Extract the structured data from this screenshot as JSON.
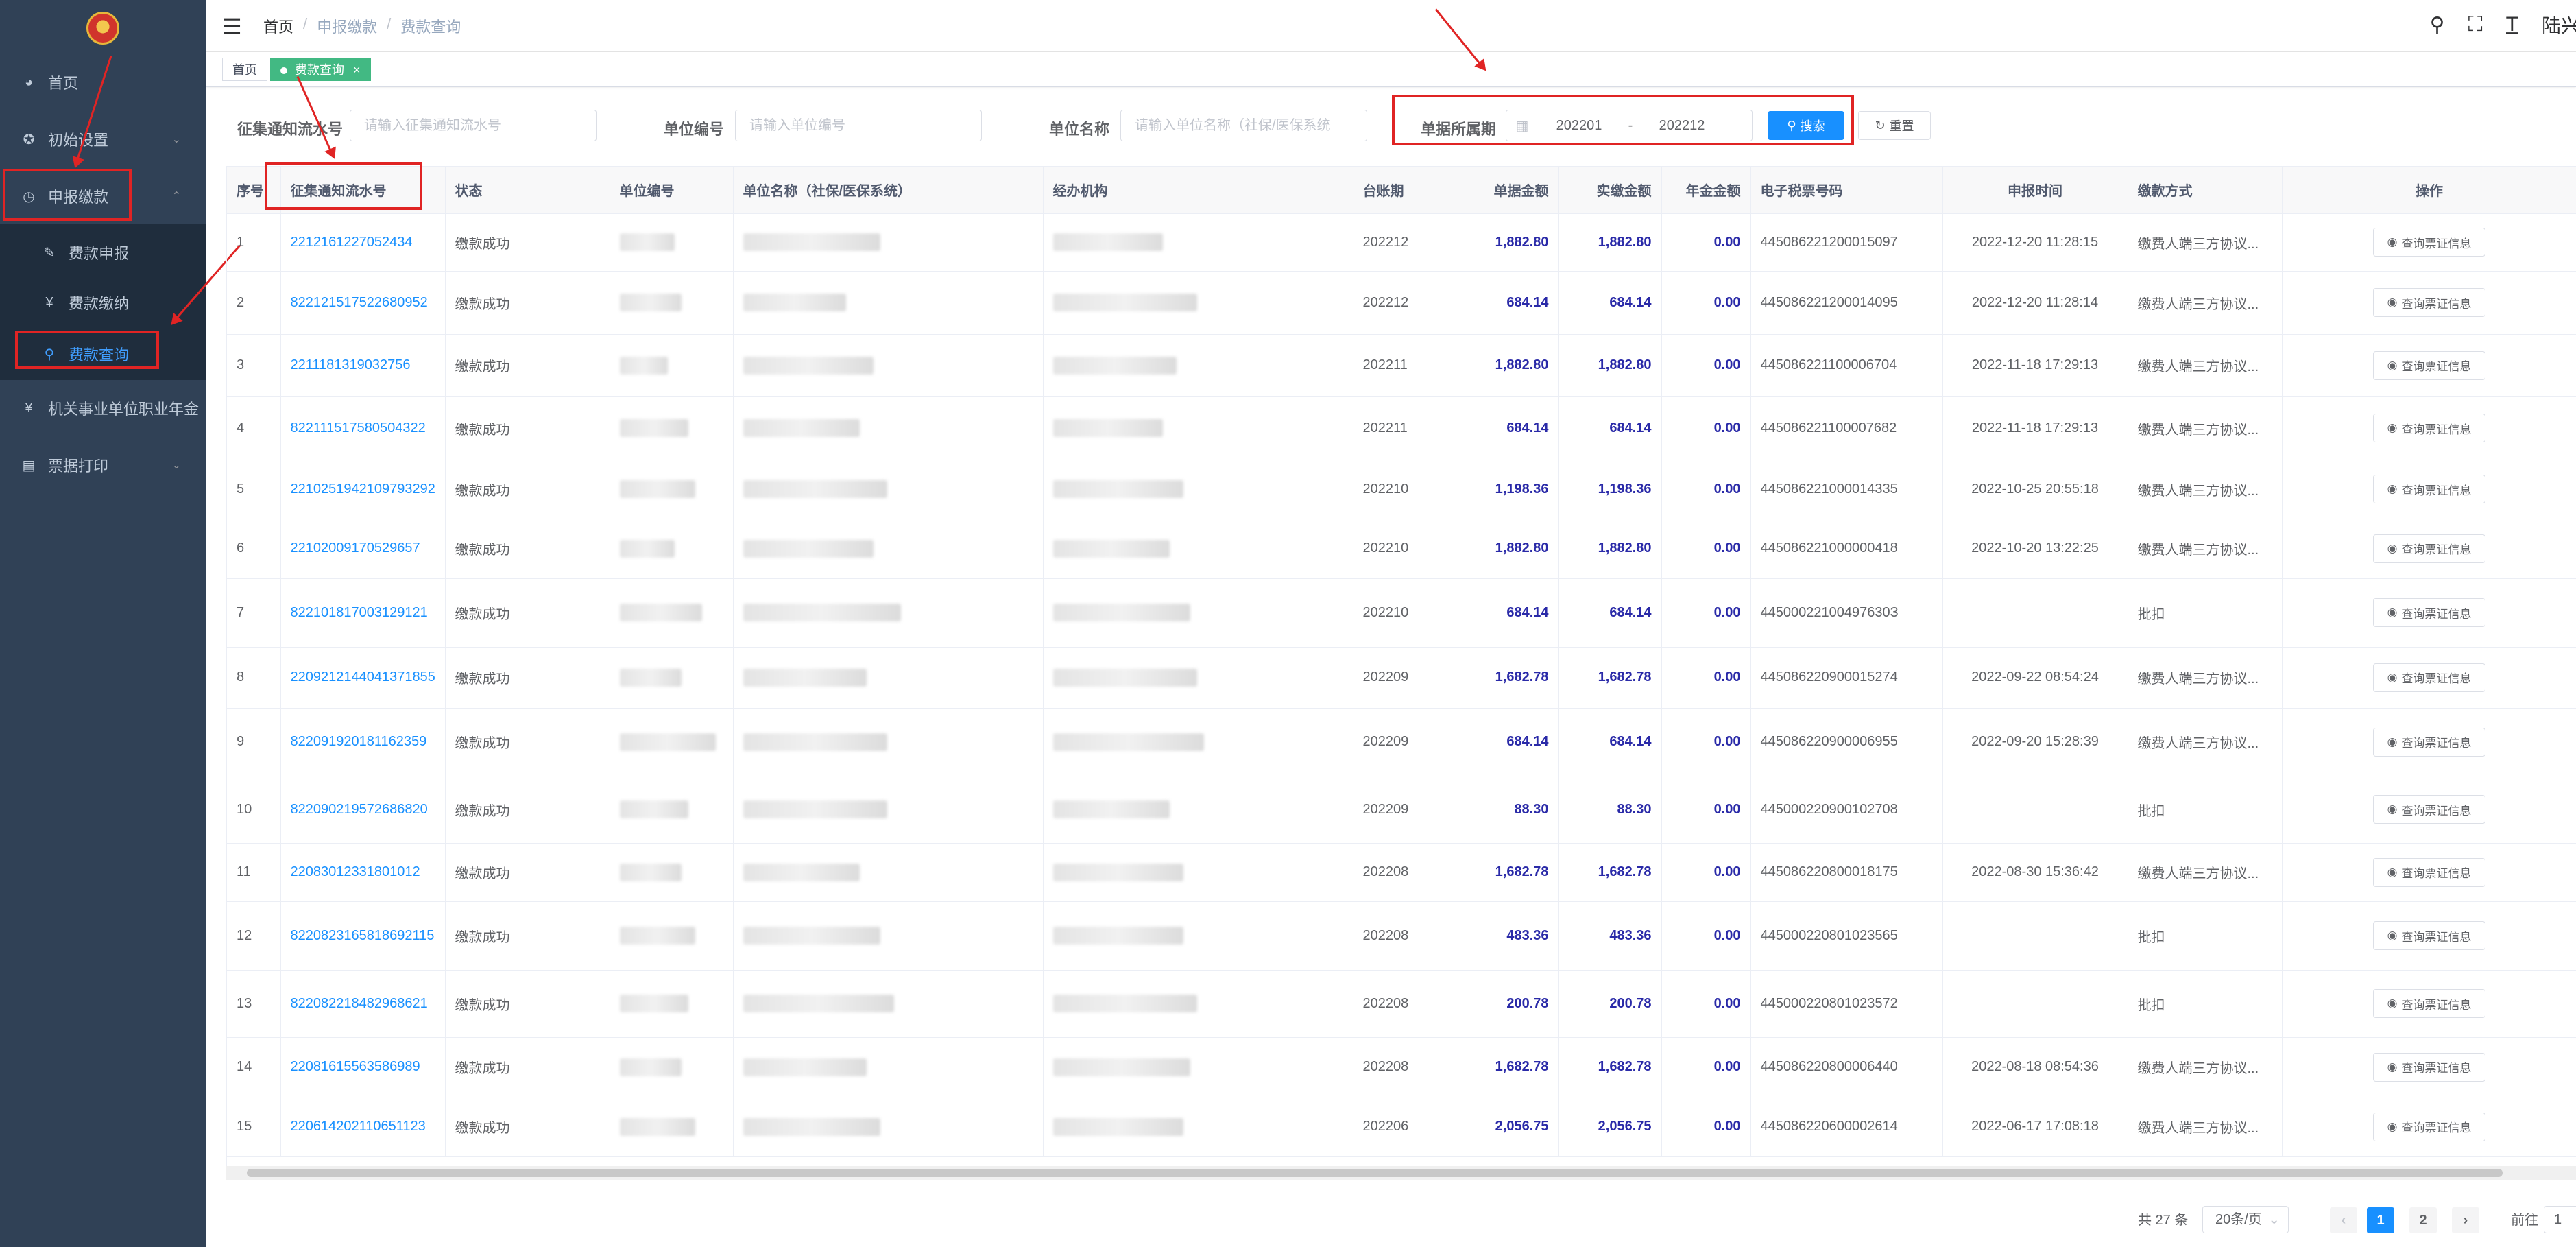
{
  "sidebar": {
    "items": [
      {
        "label": "首页",
        "icon": "dashboard-icon"
      },
      {
        "label": "初始设置",
        "icon": "settings-icon"
      },
      {
        "label": "申报缴款",
        "icon": "clock-icon"
      },
      {
        "label": "费款申报",
        "icon": "edit-icon"
      },
      {
        "label": "费款缴纳",
        "icon": "yen-icon"
      },
      {
        "label": "费款查询",
        "icon": "search-icon"
      },
      {
        "label": "机关事业单位职业年金",
        "icon": "yen-icon"
      },
      {
        "label": "票据打印",
        "icon": "printer-icon"
      }
    ]
  },
  "navbar": {
    "breadcrumb": [
      "首页",
      "申报缴款",
      "费款查询"
    ],
    "user": "陆兴"
  },
  "tags": [
    {
      "label": "首页"
    },
    {
      "label": "费款查询",
      "close": "×"
    }
  ],
  "filters": {
    "notice_label": "征集通知流水号",
    "notice_placeholder": "请输入征集通知流水号",
    "unit_no_label": "单位编号",
    "unit_no_placeholder": "请输入单位编号",
    "unit_name_label": "单位名称",
    "unit_name_placeholder": "请输入单位名称（社保/医保系统",
    "period_label": "单据所属期",
    "period_start": "202201",
    "period_sep": "-",
    "period_end": "202212",
    "search": "搜索",
    "reset": "重置"
  },
  "table": {
    "headers": [
      "序号",
      "征集通知流水号",
      "状态",
      "单位编号",
      "单位名称（社保/医保系统）",
      "经办机构",
      "台账期",
      "单据金额",
      "实缴金额",
      "年金金额",
      "电子税票号码",
      "申报时间",
      "缴款方式",
      "操作"
    ],
    "action_label": "查询票证信息",
    "rows": [
      {
        "no": "1",
        "serial": "2212161227052434",
        "status": "缴款成功",
        "period": "202212",
        "amount": "1,882.80",
        "paid": "1,882.80",
        "annuity": "0.00",
        "tax": "445086221200015097",
        "time": "2022-12-20 11:28:15",
        "method": "缴费人端三方协议..."
      },
      {
        "no": "2",
        "serial": "822121517522680952",
        "status": "缴款成功",
        "period": "202212",
        "amount": "684.14",
        "paid": "684.14",
        "annuity": "0.00",
        "tax": "445086221200014095",
        "time": "2022-12-20 11:28:14",
        "method": "缴费人端三方协议..."
      },
      {
        "no": "3",
        "serial": "2211181319032756",
        "status": "缴款成功",
        "period": "202211",
        "amount": "1,882.80",
        "paid": "1,882.80",
        "annuity": "0.00",
        "tax": "445086221100006704",
        "time": "2022-11-18 17:29:13",
        "method": "缴费人端三方协议..."
      },
      {
        "no": "4",
        "serial": "822111517580504322",
        "status": "缴款成功",
        "period": "202211",
        "amount": "684.14",
        "paid": "684.14",
        "annuity": "0.00",
        "tax": "445086221100007682",
        "time": "2022-11-18 17:29:13",
        "method": "缴费人端三方协议..."
      },
      {
        "no": "5",
        "serial": "2210251942109793292",
        "status": "缴款成功",
        "period": "202210",
        "amount": "1,198.36",
        "paid": "1,198.36",
        "annuity": "0.00",
        "tax": "445086221000014335",
        "time": "2022-10-25 20:55:18",
        "method": "缴费人端三方协议..."
      },
      {
        "no": "6",
        "serial": "22102009170529657",
        "status": "缴款成功",
        "period": "202210",
        "amount": "1,882.80",
        "paid": "1,882.80",
        "annuity": "0.00",
        "tax": "445086221000000418",
        "time": "2022-10-20 13:22:25",
        "method": "缴费人端三方协议..."
      },
      {
        "no": "7",
        "serial": "822101817003129121",
        "status": "缴款成功",
        "period": "202210",
        "amount": "684.14",
        "paid": "684.14",
        "annuity": "0.00",
        "tax": "44500022100497630З",
        "time": "",
        "method": "批扣"
      },
      {
        "no": "8",
        "serial": "2209212144041371855",
        "status": "缴款成功",
        "period": "202209",
        "amount": "1,682.78",
        "paid": "1,682.78",
        "annuity": "0.00",
        "tax": "445086220900015274",
        "time": "2022-09-22 08:54:24",
        "method": "缴费人端三方协议..."
      },
      {
        "no": "9",
        "serial": "822091920181162359",
        "status": "缴款成功",
        "period": "202209",
        "amount": "684.14",
        "paid": "684.14",
        "annuity": "0.00",
        "tax": "445086220900006955",
        "time": "2022-09-20 15:28:39",
        "method": "缴费人端三方协议..."
      },
      {
        "no": "10",
        "serial": "822090219572686820",
        "status": "缴款成功",
        "period": "202209",
        "amount": "88.30",
        "paid": "88.30",
        "annuity": "0.00",
        "tax": "445000220900102708",
        "time": "",
        "method": "批扣"
      },
      {
        "no": "11",
        "serial": "22083012331801012",
        "status": "缴款成功",
        "period": "202208",
        "amount": "1,682.78",
        "paid": "1,682.78",
        "annuity": "0.00",
        "tax": "445086220800018175",
        "time": "2022-08-30 15:36:42",
        "method": "缴费人端三方协议..."
      },
      {
        "no": "12",
        "serial": "8220823165818692115",
        "status": "缴款成功",
        "period": "202208",
        "amount": "483.36",
        "paid": "483.36",
        "annuity": "0.00",
        "tax": "445000220801023565",
        "time": "",
        "method": "批扣"
      },
      {
        "no": "13",
        "serial": "822082218482968621",
        "status": "缴款成功",
        "period": "202208",
        "amount": "200.78",
        "paid": "200.78",
        "annuity": "0.00",
        "tax": "445000220801023572",
        "time": "",
        "method": "批扣"
      },
      {
        "no": "14",
        "serial": "22081615563586989",
        "status": "缴款成功",
        "period": "202208",
        "amount": "1,682.78",
        "paid": "1,682.78",
        "annuity": "0.00",
        "tax": "445086220800006440",
        "time": "2022-08-18 08:54:36",
        "method": "缴费人端三方协议..."
      },
      {
        "no": "15",
        "serial": "220614202110651123",
        "status": "缴款成功",
        "period": "202206",
        "amount": "2,056.75",
        "paid": "2,056.75",
        "annuity": "0.00",
        "tax": "445086220600002614",
        "time": "2022-06-17 17:08:18",
        "method": "缴费人端三方协议..."
      }
    ]
  },
  "pagination": {
    "total": "共 27 条",
    "page_size": "20条/页",
    "pages": [
      "1",
      "2"
    ],
    "goto_label": "前往",
    "goto_value": "1"
  }
}
